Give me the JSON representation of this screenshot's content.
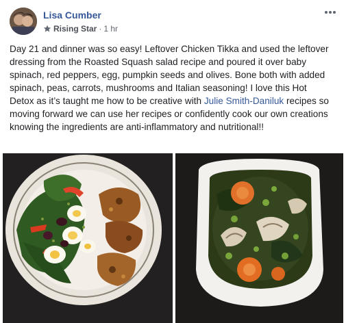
{
  "post": {
    "author": "Lisa Cumber",
    "badge": "Rising Star",
    "separator": "·",
    "time": "1 hr",
    "text_before_link": "Day 21 and dinner was so easy! Leftover Chicken Tikka and used the leftover dressing from the Roasted Squash salad recipe and poured it over baby spinach, red peppers, egg, pumpkin seeds and olives. Bone both with added spinach, peas, carrots, mushrooms and Italian seasoning! I love this Hot Detox as it’s taught me how to be creative with ",
    "link_text": "Julie Smith-Daniluk",
    "text_after_link": " recipes so moving forward we can use her recipes or confidently cook our own creations knowing the ingredients are anti-inflammatory and nutritional!!"
  },
  "icons": {
    "badge": "star-badge-icon",
    "menu": "more-options-icon"
  },
  "colors": {
    "author_link": "#365899",
    "meta_text": "#606770",
    "body_text": "#1c1e21"
  }
}
